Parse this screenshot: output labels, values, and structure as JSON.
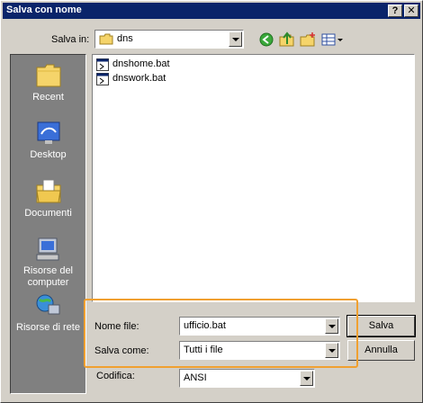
{
  "window": {
    "title": "Salva con nome",
    "help_glyph": "?",
    "close_glyph": "✕"
  },
  "toolbar": {
    "save_in_label": "Salva in:",
    "save_in_value": "dns",
    "icons": [
      "back-icon",
      "up-folder-icon",
      "new-folder-icon",
      "view-menu-icon"
    ]
  },
  "places": [
    {
      "label": "Recent",
      "icon": "recent-icon"
    },
    {
      "label": "Desktop",
      "icon": "desktop-icon"
    },
    {
      "label": "Documenti",
      "icon": "documents-icon"
    },
    {
      "label": "Risorse del computer",
      "icon": "my-computer-icon"
    },
    {
      "label": "Risorse di rete",
      "icon": "network-icon"
    }
  ],
  "files": [
    {
      "name": "dnshome.bat",
      "icon": "batch-file-icon"
    },
    {
      "name": "dnswork.bat",
      "icon": "batch-file-icon"
    }
  ],
  "form": {
    "filename_label": "Nome file:",
    "filename_value": "ufficio.bat",
    "type_label": "Salva come:",
    "type_value": "Tutti i file",
    "encoding_label": "Codifica:",
    "encoding_value": "ANSI"
  },
  "buttons": {
    "save": "Salva",
    "cancel": "Annulla"
  },
  "colors": {
    "titlebar": "#0a246a",
    "highlight": "#f0a030",
    "places_bg": "#808080"
  }
}
